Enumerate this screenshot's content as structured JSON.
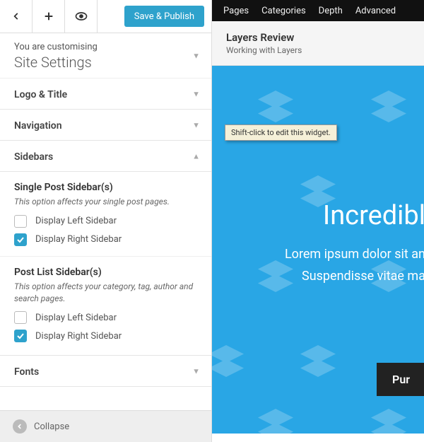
{
  "toolbar": {
    "save_label": "Save & Publish"
  },
  "title": {
    "subtitle": "You are customising",
    "main": "Site Settings"
  },
  "accordion": [
    {
      "label": "Logo & Title",
      "open": false
    },
    {
      "label": "Navigation",
      "open": false
    },
    {
      "label": "Sidebars",
      "open": true
    },
    {
      "label": "Fonts",
      "open": false
    }
  ],
  "sidebars": {
    "group1": {
      "title": "Single Post Sidebar(s)",
      "desc": "This option affects your single post pages.",
      "opts": [
        {
          "label": "Display Left Sidebar",
          "checked": false
        },
        {
          "label": "Display Right Sidebar",
          "checked": true
        }
      ]
    },
    "group2": {
      "title": "Post List Sidebar(s)",
      "desc": "This option affects your category, tag, author and search pages.",
      "opts": [
        {
          "label": "Display Left Sidebar",
          "checked": false
        },
        {
          "label": "Display Right Sidebar",
          "checked": true
        }
      ]
    }
  },
  "collapse": {
    "label": "Collapse"
  },
  "preview": {
    "menu": [
      "Pages",
      "Categories",
      "Depth",
      "Advanced"
    ],
    "site_title": "Layers Review",
    "site_tagline": "Working with Layers",
    "hero_title": "Incredibl",
    "hero_line1": "Lorem ipsum dolor sit an",
    "hero_line2": "Suspendisse vitae ma",
    "hero_button": "Pur",
    "tooltip": "Shift-click to edit this widget."
  }
}
